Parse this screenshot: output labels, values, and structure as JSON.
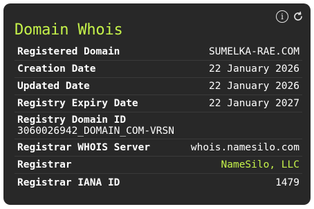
{
  "card": {
    "title": "Domain Whois",
    "info_icon": "info-icon",
    "refresh_icon": "refresh-icon"
  },
  "rows": [
    {
      "label": "Registered Domain",
      "value": "SUMELKA-RAE.COM"
    },
    {
      "label": "Creation Date",
      "value": "22 January 2026"
    },
    {
      "label": "Updated Date",
      "value": "22 January 2026"
    },
    {
      "label": "Registry Expiry Date",
      "value": "22 January 2027"
    },
    {
      "label": "Registry Domain ID",
      "value": "3060026942_DOMAIN_COM-VRSN"
    },
    {
      "label": "Registrar WHOIS Server",
      "value": "whois.namesilo.com"
    },
    {
      "label": "Registrar",
      "value": "NameSilo, LLC"
    },
    {
      "label": "Registrar IANA ID",
      "value": "1479"
    }
  ],
  "colors": {
    "accent": "#c5f24a",
    "card_background": "#282828",
    "text": "#ffffff"
  }
}
